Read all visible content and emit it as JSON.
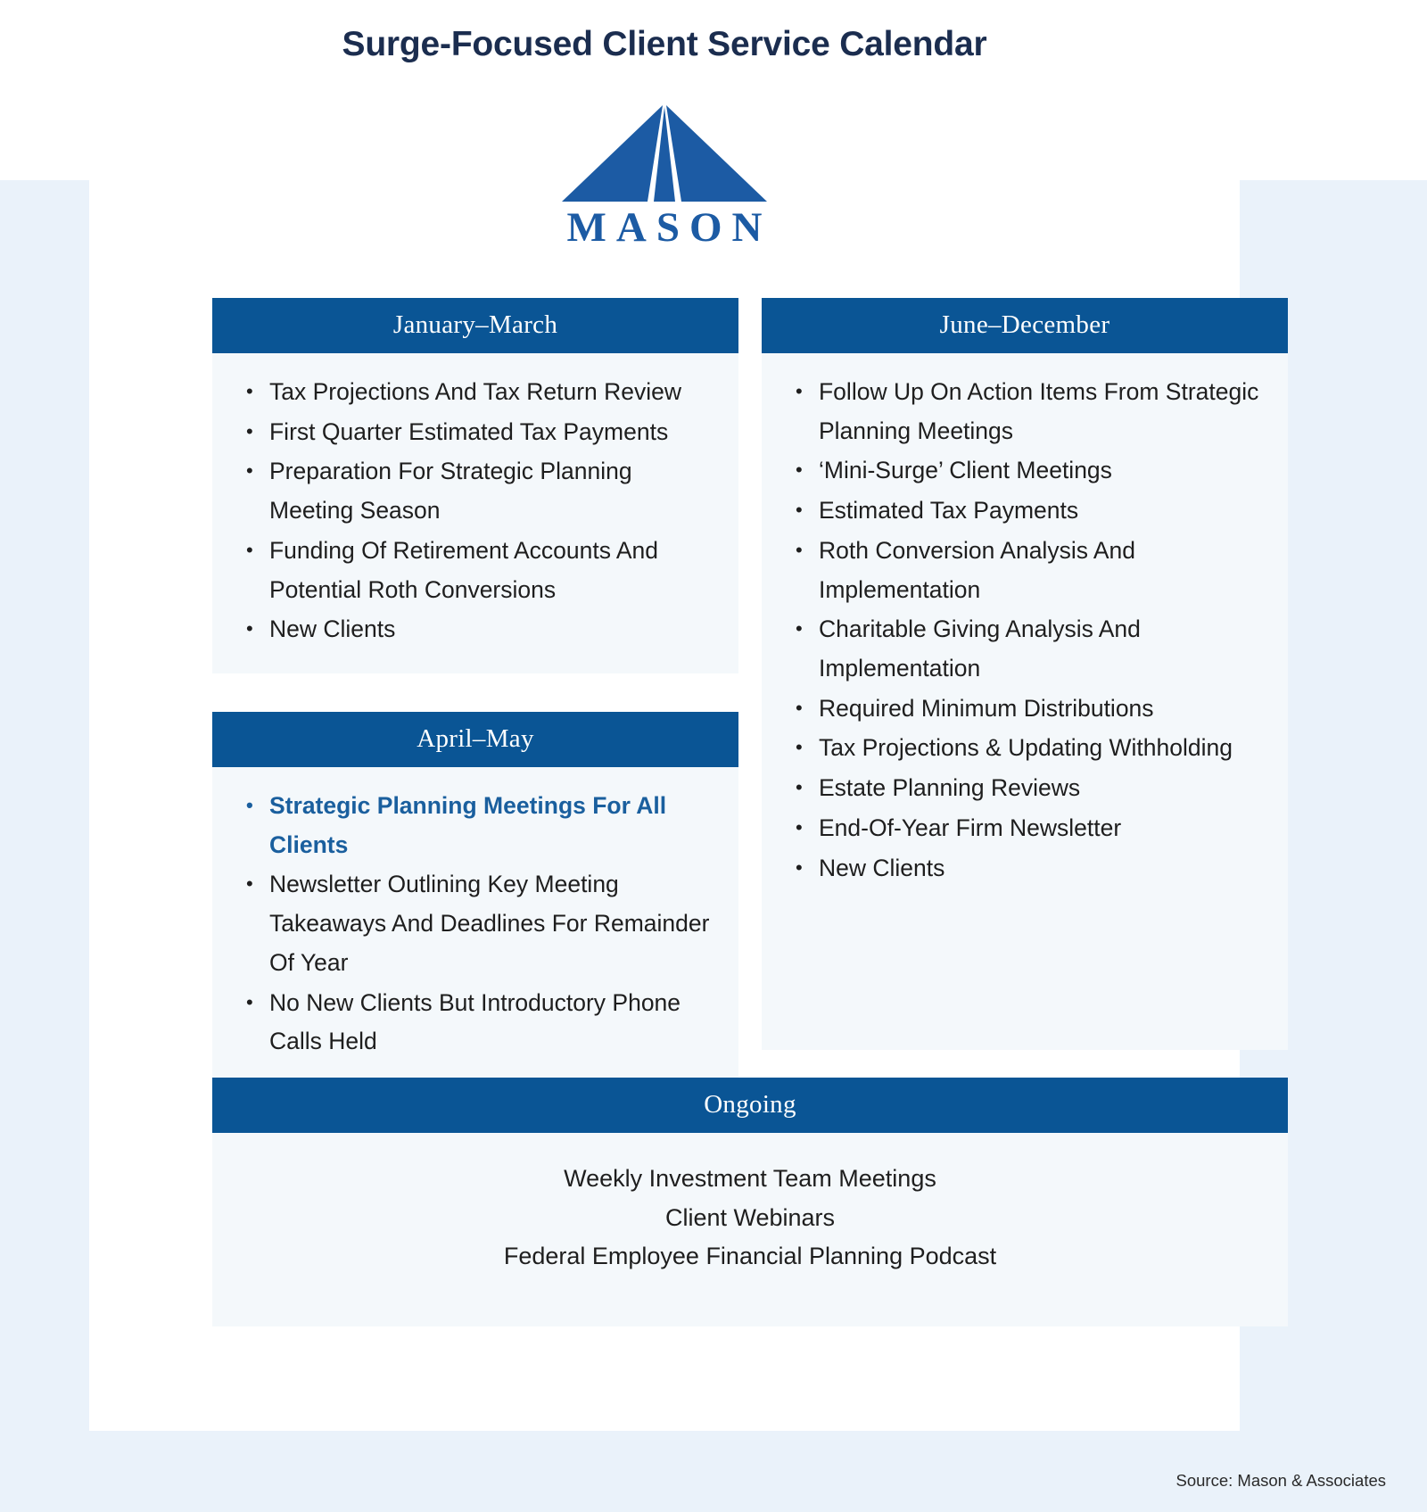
{
  "page": {
    "title": "Surge-Focused Client Service Calendar",
    "source": "Source: Mason & Associates"
  },
  "brand": {
    "logo_icon": "mason-pyramid-logo-icon",
    "wordmark": "MASON",
    "logo_color": "#1c5ba4",
    "header_color": "#0a5595",
    "accent_color": "#1a5f9e",
    "title_color": "#1b2d4f",
    "card_bg": "#f4f8fb",
    "page_bg": "#eaf2fa"
  },
  "cards": {
    "q1": {
      "header": "January–March",
      "items": [
        {
          "text": "Tax Projections And Tax Return Review",
          "highlight": false
        },
        {
          "text": "First Quarter Estimated Tax Payments",
          "highlight": false
        },
        {
          "text": "Preparation For Strategic Planning Meeting Season",
          "highlight": false
        },
        {
          "text": "Funding Of Retirement Accounts And Potential Roth Conversions",
          "highlight": false
        },
        {
          "text": "New Clients",
          "highlight": false
        }
      ]
    },
    "q2": {
      "header": "April–May",
      "items": [
        {
          "text": "Strategic Planning Meetings For All Clients",
          "highlight": true
        },
        {
          "text": "Newsletter Outlining Key Meeting Takeaways And Deadlines For Remainder Of Year",
          "highlight": false
        },
        {
          "text": "No New Clients But Introductory Phone Calls Held",
          "highlight": false
        }
      ]
    },
    "h2": {
      "header": "June–December",
      "items": [
        {
          "text": "Follow Up On Action Items From Strategic Planning Meetings",
          "highlight": false
        },
        {
          "text": "‘Mini-Surge’ Client Meetings",
          "highlight": false
        },
        {
          "text": "Estimated Tax Payments",
          "highlight": false
        },
        {
          "text": "Roth Conversion Analysis And Implementation",
          "highlight": false
        },
        {
          "text": "Charitable Giving Analysis And Implementation",
          "highlight": false
        },
        {
          "text": "Required Minimum Distributions",
          "highlight": false
        },
        {
          "text": "Tax Projections & Updating Withholding",
          "highlight": false
        },
        {
          "text": "Estate Planning Reviews",
          "highlight": false
        },
        {
          "text": "End-Of-Year Firm Newsletter",
          "highlight": false
        },
        {
          "text": "New Clients",
          "highlight": false
        }
      ]
    },
    "ongoing": {
      "header": "Ongoing",
      "lines": [
        "Weekly Investment Team Meetings",
        "Client Webinars",
        "Federal Employee Financial Planning Podcast"
      ]
    }
  }
}
